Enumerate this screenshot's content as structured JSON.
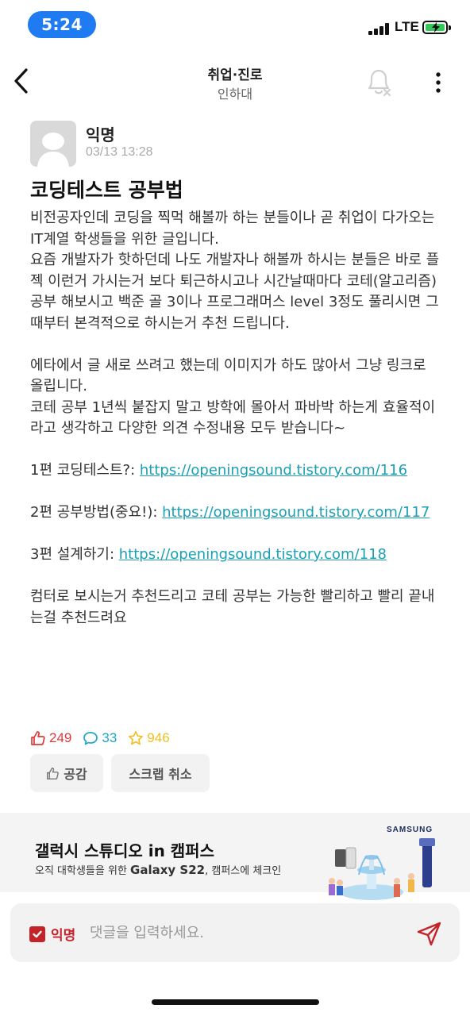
{
  "status_bar": {
    "time": "5:24",
    "network": "LTE"
  },
  "nav": {
    "title": "취업·진로",
    "subtitle": "인하대"
  },
  "post": {
    "author": "익명",
    "timestamp": "03/13 13:28",
    "title": "코딩테스트 공부법",
    "body": [
      "비전공자인데 코딩을 찍먹 해볼까 하는 분들이나 곧 취업이 다가오는 IT계열 학생들을 위한 글입니다.",
      "요즘 개발자가 핫하던데 나도 개발자나 해볼까 하시는 분들은 바로 플젝 이런거 가시는거 보다 퇴근하시고나 시간날때마다 코테(알고리즘) 공부 해보시고 백준 골 3이나 프로그래머스 level 3정도 풀리시면 그때부터 본격적으로 하시는거 추천 드립니다.",
      "에타에서 글 새로 쓰려고 했는데 이미지가 하도 많아서 그냥 링크로 올립니다.",
      "코테 공부 1년씩 붙잡지 말고 방학에 몰아서 파바박 하는게 효율적이라고 생각하고 다양한 의견 수정내용 모두 받습니다~"
    ],
    "links": [
      {
        "prefix": "1편 코딩테스트?: ",
        "url": "https://openingsound.tistory.com/116"
      },
      {
        "prefix": "2편 공부방법(중요!): ",
        "url": "https://openingsound.tistory.com/117"
      },
      {
        "prefix": "3편 설계하기: ",
        "url": "https://openingsound.tistory.com/118"
      }
    ],
    "closing": "컴터로 보시는거 추천드리고 코테 공부는 가능한 빨리하고 빨리 끝내는걸 추천드려요",
    "likes": "249",
    "comments": "33",
    "scraps": "946"
  },
  "actions": {
    "like_label": "공감",
    "scrap_label": "스크랩 취소"
  },
  "ad": {
    "title": "갤럭시 스튜디오 in 캠퍼스",
    "sub_prefix": "오직 대학생들을 위한 ",
    "sub_highlight": "Galaxy S22",
    "sub_suffix": ", 캠퍼스에 체크인",
    "brand": "SAMSUNG"
  },
  "comment_bar": {
    "anon_label": "익명",
    "placeholder": "댓글을 입력하세요."
  },
  "icons": {
    "back": "chevron-left-icon",
    "bell": "bell-off-icon",
    "more": "more-vertical-icon",
    "like": "thumbs-up-icon",
    "comment": "comment-icon",
    "scrap": "star-icon",
    "send": "send-icon"
  },
  "colors": {
    "accent": "#c5232a",
    "like": "#e2383b",
    "comment": "#1da8c9",
    "scrap": "#f1c024",
    "link": "#1a9fb5",
    "time_pill": "#1e7bf2"
  }
}
